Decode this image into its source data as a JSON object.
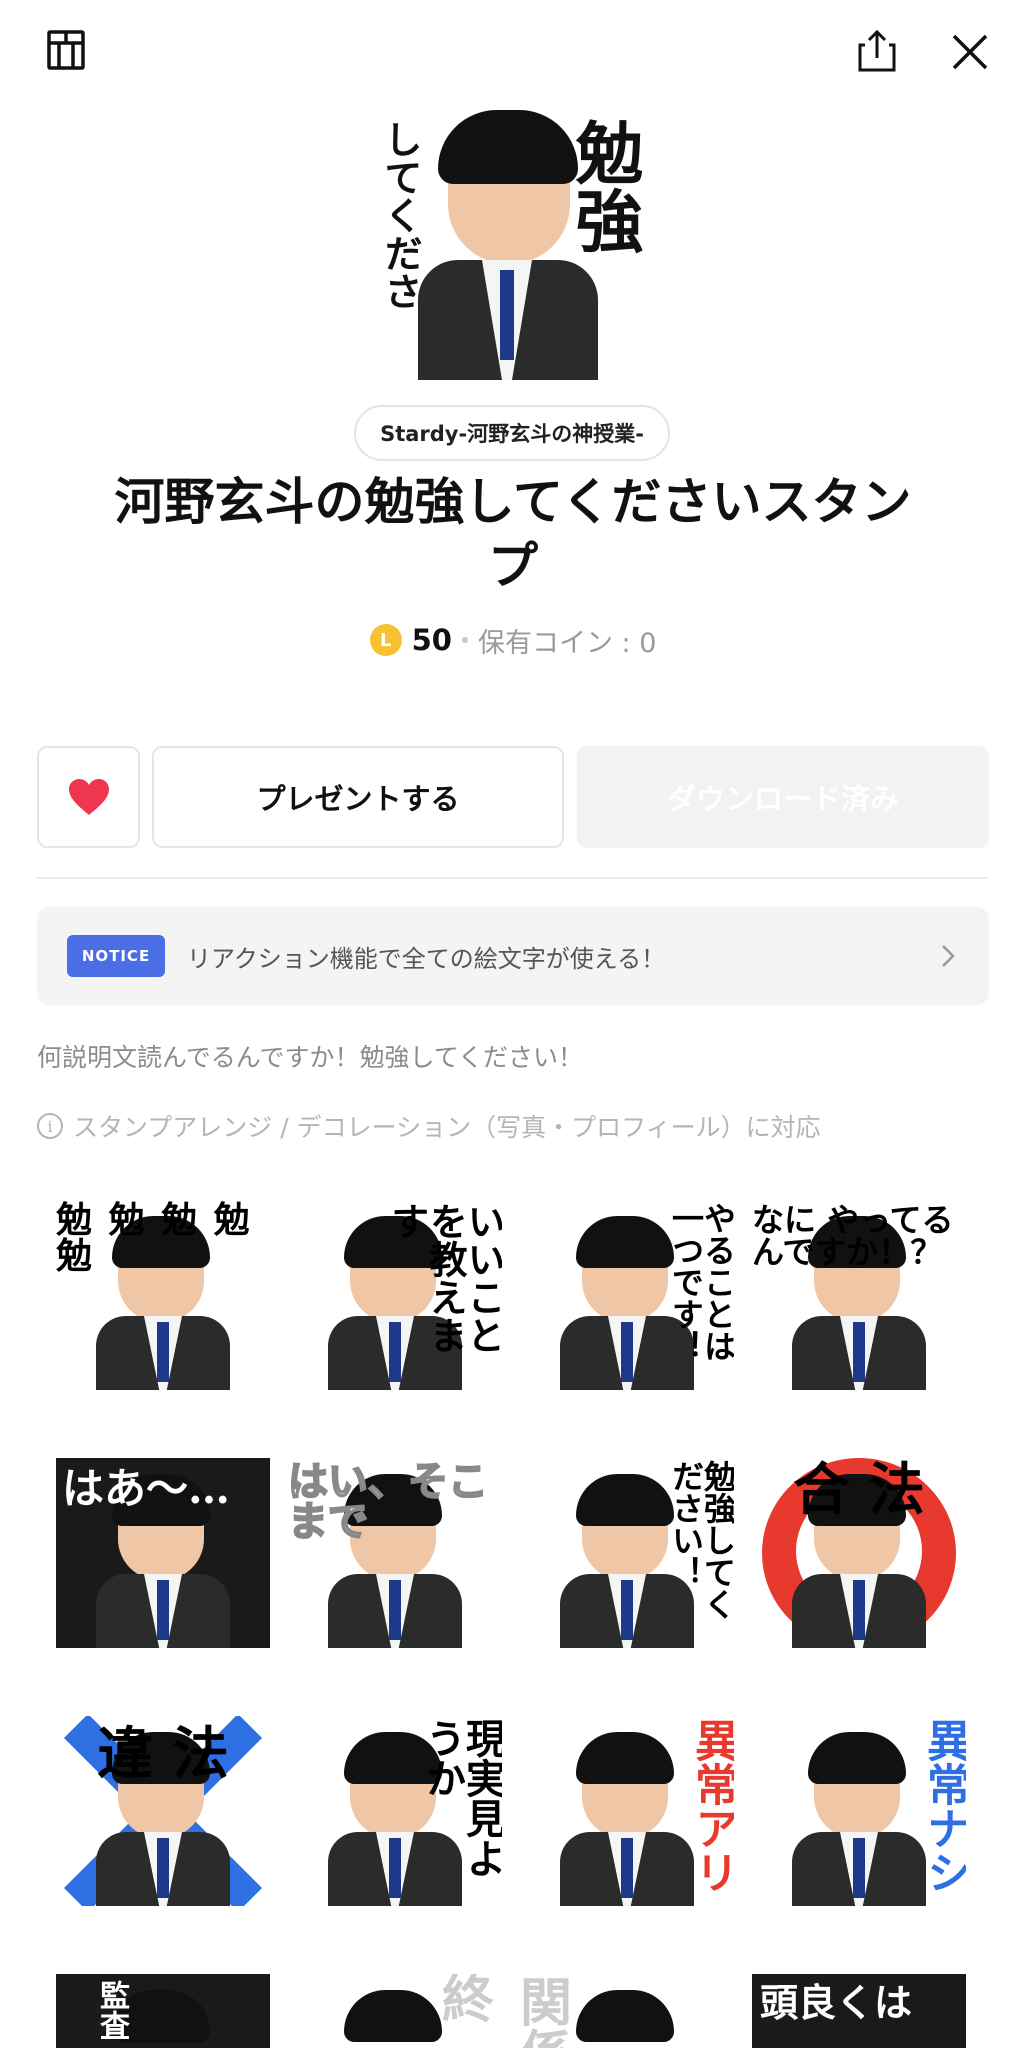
{
  "topbar": {
    "left_icon": "shop-icon",
    "share_icon": "share-icon",
    "close_icon": "close-icon"
  },
  "hero": {
    "caption_main": "勉強",
    "caption_side": "してください！"
  },
  "creator": "Stardy-河野玄斗の神授業-",
  "title": "河野玄斗の勉強してくださいスタンプ",
  "price": {
    "coin_label": "L",
    "amount": "50",
    "owned_label": "保有コイン : 0"
  },
  "actions": {
    "favorite_icon": "heart-icon",
    "gift_label": "プレゼントする",
    "download_label": "ダウンロード済み"
  },
  "notice": {
    "badge": "NOTICE",
    "text": "リアクション機能で全ての絵文字が使える！"
  },
  "description": "何説明文読んでるんですか！勉強してください！",
  "compat_text": "スタンプアレンジ / デコレーション（写真・プロフィール）に対応",
  "colors": {
    "accent_blue": "#4b6ee7",
    "coin_yellow": "#f6c231",
    "heart_red": "#f0364f"
  },
  "stickers": [
    {
      "caption": "勉 勉 勉 勉 勉"
    },
    {
      "caption": "いいことを教えます"
    },
    {
      "caption": "やることは一つです！"
    },
    {
      "caption": "なに やってるんですか！？"
    },
    {
      "caption": "はあ〜…"
    },
    {
      "caption": "はい、そこまで"
    },
    {
      "caption": "勉強してください！"
    },
    {
      "caption": "合 法"
    },
    {
      "caption": "違 法"
    },
    {
      "caption": "現実見ようか"
    },
    {
      "caption": "異常アリ"
    },
    {
      "caption": "異常ナシ"
    },
    {
      "caption": "監査"
    },
    {
      "caption": "終"
    },
    {
      "caption": "関係"
    },
    {
      "caption": "頭良くは"
    }
  ]
}
